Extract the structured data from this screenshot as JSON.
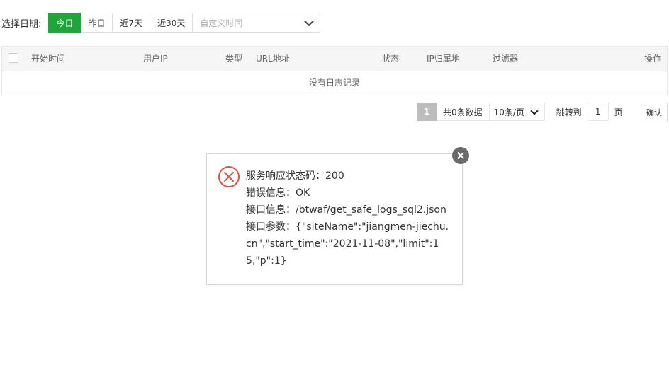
{
  "filter": {
    "label": "选择日期:",
    "buttons": [
      "今日",
      "昨日",
      "近7天",
      "近30天"
    ],
    "active_index": 0,
    "custom_placeholder": "自定义时间"
  },
  "table": {
    "columns": [
      "开始时间",
      "用户IP",
      "类型",
      "URL地址",
      "状态",
      "IP归属地",
      "过滤器",
      "操作"
    ],
    "empty_text": "没有日志记录"
  },
  "pagination": {
    "current_page": "1",
    "total_text": "共0条数据",
    "page_size": "10条/页",
    "jump_label": "跳转到",
    "jump_value": "1",
    "page_suffix": "页",
    "confirm_label": "确认"
  },
  "dialog": {
    "status_line": "服务响应状态码：200",
    "error_line": "错误信息：OK",
    "api_line": "接口信息：/btwaf/get_safe_logs_sql2.json",
    "params_line": "接口参数：{\"siteName\":\"jiangmen-jiechu.cn\",\"start_time\":\"2021-11-08\",\"limit\":15,\"p\":1}"
  },
  "colors": {
    "accent": "#20a53a",
    "error": "#e0503c",
    "close": "#6b6b6b"
  }
}
